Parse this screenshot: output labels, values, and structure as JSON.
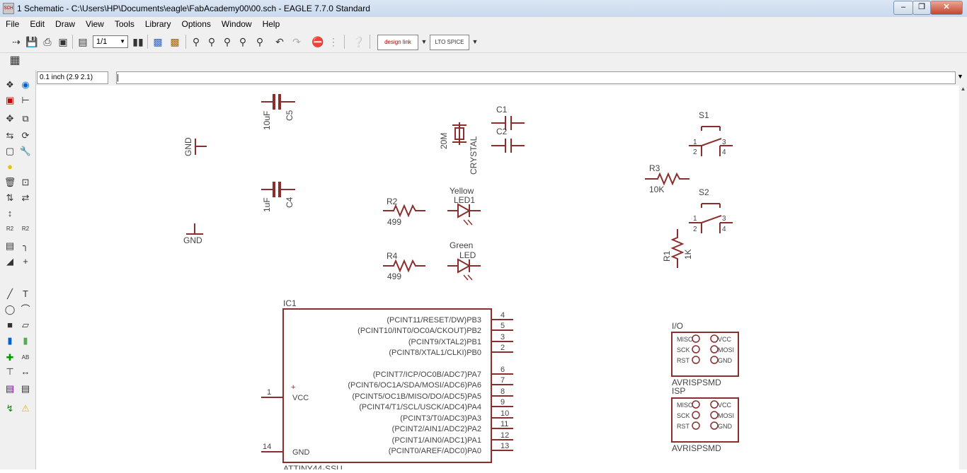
{
  "window": {
    "icon_text": "SCH",
    "title": "1 Schematic - C:\\Users\\HP\\Documents\\eagle\\FabAcademy00\\00.sch - EAGLE 7.7.0 Standard"
  },
  "menu": [
    "File",
    "Edit",
    "Draw",
    "View",
    "Tools",
    "Library",
    "Options",
    "Window",
    "Help"
  ],
  "toolbar": {
    "sheet_select": "1/1",
    "designlink_label": "design link",
    "ltspice_label": "LTO SPICE"
  },
  "command_bar": {
    "coordinates": "0.1 inch (2.9 2.1)",
    "command_text": "|"
  },
  "schematic": {
    "capacitors": [
      {
        "name": "C5",
        "value": "10uF"
      },
      {
        "name": "C4",
        "value": "1uF"
      },
      {
        "name": "C1",
        "value": ""
      },
      {
        "name": "C2",
        "value": ""
      }
    ],
    "gnd1": "GND",
    "gnd2": "GND",
    "crystal": {
      "name": "CRYSTAL",
      "value": "20M"
    },
    "resistors": [
      {
        "name": "R2",
        "value": "499"
      },
      {
        "name": "R4",
        "value": "499"
      },
      {
        "name": "R3",
        "value": "10K"
      },
      {
        "name": "R1",
        "value": "1K"
      }
    ],
    "leds": [
      {
        "name": "LED1",
        "value": "Yellow"
      },
      {
        "name": "LED",
        "value": "Green"
      }
    ],
    "switches": [
      {
        "name": "S1",
        "pins": [
          "1",
          "2",
          "3",
          "4"
        ]
      },
      {
        "name": "S2",
        "pins": [
          "1",
          "2",
          "3",
          "4"
        ]
      }
    ],
    "ic": {
      "name": "IC1",
      "value": "ATTINY44-SSU",
      "left_pins": [
        {
          "num": "1",
          "label": "VCC"
        },
        {
          "num": "14",
          "label": "GND"
        }
      ],
      "right_pins": [
        {
          "num": "4",
          "label": "(PCINT11/RESET/DW)PB3"
        },
        {
          "num": "5",
          "label": "(PCINT10/INT0/OC0A/CKOUT)PB2"
        },
        {
          "num": "3",
          "label": "(PCINT9/XTAL2)PB1"
        },
        {
          "num": "2",
          "label": "(PCINT8/XTAL1/CLKI)PB0"
        },
        {
          "num": "6",
          "label": "(PCINT7/ICP/OC0B/ADC7)PA7"
        },
        {
          "num": "7",
          "label": "(PCINT6/OC1A/SDA/MOSI/ADC6)PA6"
        },
        {
          "num": "8",
          "label": "(PCINT5/OC1B/MISO/DO/ADC5)PA5"
        },
        {
          "num": "9",
          "label": "(PCINT4/T1/SCL/USCK/ADC4)PA4"
        },
        {
          "num": "10",
          "label": "(PCINT3/T0/ADC3)PA3"
        },
        {
          "num": "11",
          "label": "(PCINT2/AIN1/ADC2)PA2"
        },
        {
          "num": "12",
          "label": "(PCINT1/AIN0/ADC1)PA1"
        },
        {
          "num": "13",
          "label": "(PCINT0/AREF/ADC0)PA0"
        }
      ]
    },
    "headers": [
      {
        "name": "I/O",
        "value": "AVRISPSMD",
        "left": [
          "MISO",
          "SCK",
          "RST"
        ],
        "right": [
          "VCC",
          "MOSI",
          "GND"
        ]
      },
      {
        "name": "ISP",
        "value": "AVRISPSMD",
        "left": [
          "MISO",
          "SCK",
          "RST"
        ],
        "right": [
          "VCC",
          "MOSI",
          "GND"
        ]
      }
    ]
  },
  "colors": {
    "symbol": "#8b2e2e",
    "text": "#444444"
  }
}
